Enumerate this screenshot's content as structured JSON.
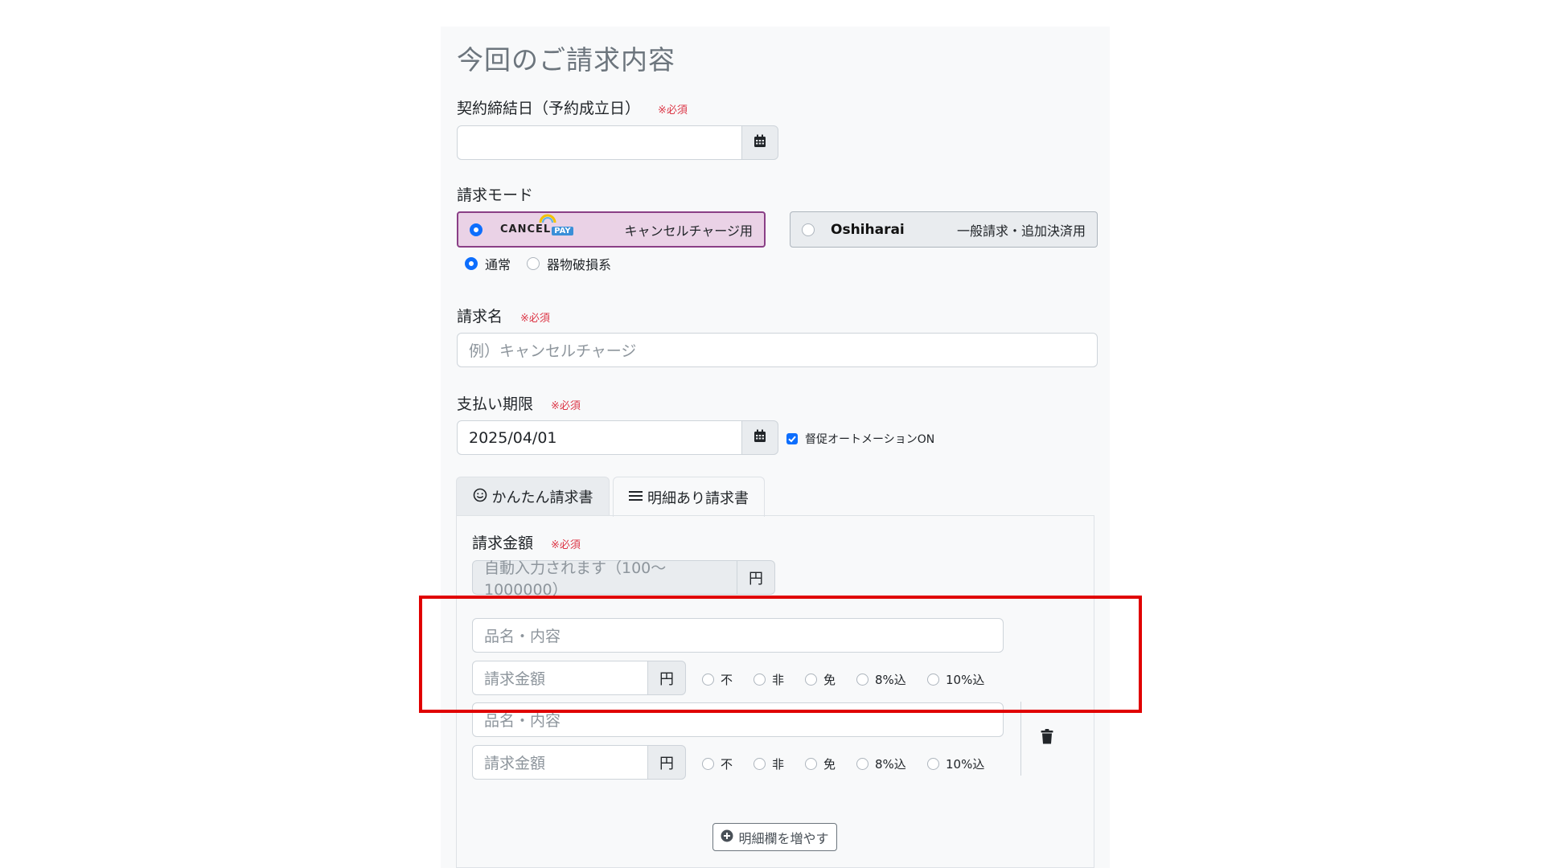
{
  "section_title": "今回のご請求内容",
  "required_mark": "※必須",
  "contract_date": {
    "label": "契約締結日（予約成立日）",
    "value": ""
  },
  "billing_mode": {
    "label": "請求モード",
    "cancelpay": {
      "logo_text_left": "CANCEL",
      "logo_text_right": "PAY",
      "description": "キャンセルチャージ用",
      "selected": true
    },
    "oshiharai": {
      "logo_text": "Oshiharai",
      "description": "一般請求・追加決済用",
      "selected": false
    },
    "sub_options": [
      {
        "label": "通常",
        "selected": true
      },
      {
        "label": "器物破損系",
        "selected": false
      }
    ]
  },
  "billing_name": {
    "label": "請求名",
    "placeholder": "例）キャンセルチャージ"
  },
  "due_date": {
    "label": "支払い期限",
    "value": "2025/04/01",
    "automation_label": "督促オートメーションON",
    "automation_checked": true
  },
  "tabs": [
    {
      "label": "かんたん請求書",
      "active": false
    },
    {
      "label": "明細あり請求書",
      "active": true
    }
  ],
  "amount": {
    "label": "請求金額",
    "placeholder": "自動入力されます（100〜1000000）",
    "unit": "円"
  },
  "line_items": [
    {
      "item_placeholder": "品名・内容",
      "amount_placeholder": "請求金額",
      "unit": "円",
      "tax_options": [
        "不",
        "非",
        "免",
        "8%込",
        "10%込"
      ]
    },
    {
      "item_placeholder": "品名・内容",
      "amount_placeholder": "請求金額",
      "unit": "円",
      "tax_options": [
        "不",
        "非",
        "免",
        "8%込",
        "10%込"
      ]
    }
  ],
  "add_line_button": "明細欄を増やす",
  "colors": {
    "accent": "#0d6efd",
    "required": "#dc3545",
    "highlight": "#e00000",
    "cancelpay_bg": "#ead2e6",
    "cancelpay_border": "#8a3f86"
  }
}
